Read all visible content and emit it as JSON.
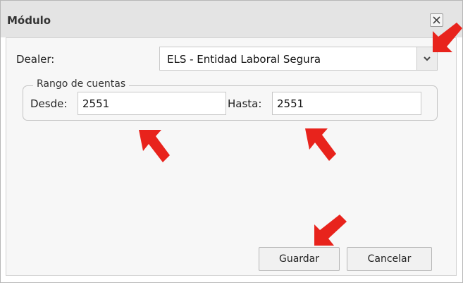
{
  "dialog": {
    "title": "Módulo",
    "close_icon": "close-icon"
  },
  "form": {
    "dealer_label": "Dealer:",
    "dealer_value": "ELS - Entidad Laboral Segura",
    "range_legend": "Rango de cuentas",
    "desde_label": "Desde:",
    "desde_value": "2551",
    "hasta_label": "Hasta:",
    "hasta_value": "2551"
  },
  "buttons": {
    "save_label": "Guardar",
    "cancel_label": "Cancelar"
  },
  "annotations": {
    "arrow_color": "#e8231c",
    "arrow_icon": "red-arrow-icon"
  }
}
